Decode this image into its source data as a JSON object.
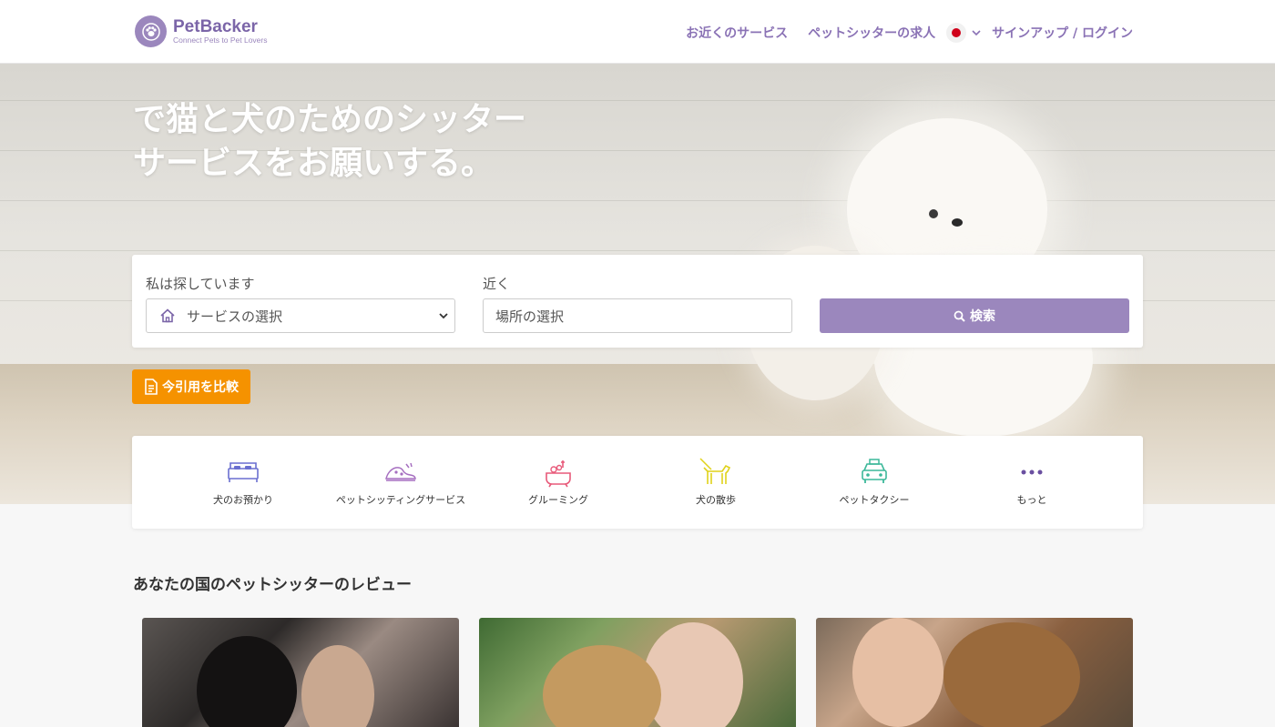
{
  "header": {
    "logo": {
      "name": "PetBacker",
      "tagline": "Connect Pets to Pet Lovers"
    },
    "nav": {
      "services": "お近くのサービス",
      "jobs": "ペットシッターの求人",
      "signup_login": "サインアップ / ログイン"
    }
  },
  "hero": {
    "title_line1": "で猫と犬のためのシッター",
    "title_line2": "サービスをお願いする。"
  },
  "search": {
    "looking_label": "私は探しています",
    "service_select_value": "サービスの選択",
    "near_label": "近く",
    "location_placeholder": "場所の選択",
    "search_button": "検索"
  },
  "quote_button": "今引用を比較",
  "services": [
    {
      "label": "犬のお預かり",
      "icon": "dog-boarding-bed-icon",
      "color": "#6a6fd0"
    },
    {
      "label": "ペットシッティングサービス",
      "icon": "pet-sitting-icon",
      "color": "#a66fc0"
    },
    {
      "label": "グルーミング",
      "icon": "grooming-bathtub-icon",
      "color": "#e85a7a"
    },
    {
      "label": "犬の散歩",
      "icon": "dog-walking-icon",
      "color": "#e0d21a"
    },
    {
      "label": "ペットタクシー",
      "icon": "pet-taxi-icon",
      "color": "#3cb89a"
    },
    {
      "label": "もっと",
      "icon": "more-dots-icon",
      "color": "#6a4fa0"
    }
  ],
  "reviews": {
    "title": "あなたの国のペットシッターのレビュー"
  },
  "colors": {
    "brand": "#9b87bd",
    "accent_orange": "#f59200",
    "nav_text": "#8a72b5"
  }
}
